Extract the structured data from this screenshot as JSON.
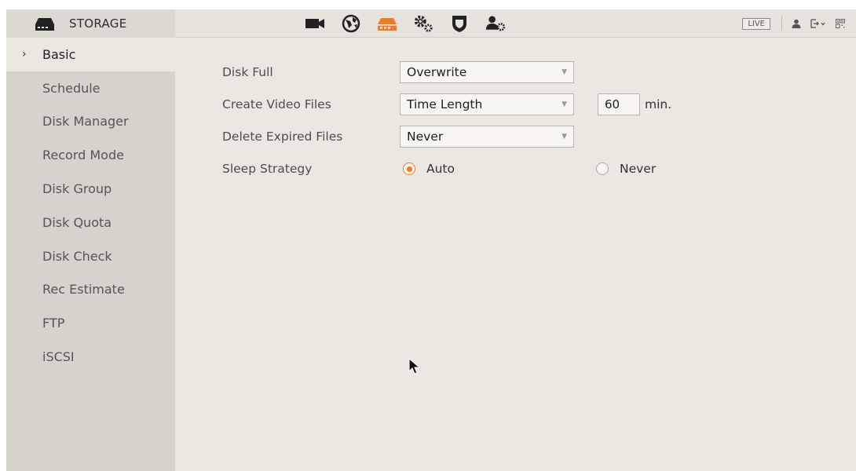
{
  "header": {
    "title": "STORAGE",
    "live_label": "LIVE",
    "nav_icons": [
      "camera-icon",
      "network-icon",
      "storage-icon",
      "system-settings-icon",
      "security-shield-icon",
      "account-settings-icon"
    ],
    "active_nav": "storage-icon",
    "tools": [
      "user-icon",
      "logout-icon",
      "qr-code-icon"
    ]
  },
  "sidebar": {
    "items": [
      {
        "label": "Basic",
        "active": true
      },
      {
        "label": "Schedule"
      },
      {
        "label": "Disk Manager"
      },
      {
        "label": "Record Mode"
      },
      {
        "label": "Disk Group"
      },
      {
        "label": "Disk Quota"
      },
      {
        "label": "Disk Check"
      },
      {
        "label": "Rec Estimate"
      },
      {
        "label": "FTP"
      },
      {
        "label": "iSCSI"
      }
    ]
  },
  "form": {
    "disk_full": {
      "label": "Disk Full",
      "value": "Overwrite"
    },
    "create_video_files": {
      "label": "Create Video Files",
      "value": "Time Length",
      "length": "60",
      "unit": "min."
    },
    "delete_expired_files": {
      "label": "Delete Expired Files",
      "value": "Never"
    },
    "sleep_strategy": {
      "label": "Sleep Strategy",
      "options": [
        "Auto",
        "Never"
      ],
      "selected": "Auto"
    }
  },
  "colors": {
    "accent": "#f07a2a",
    "sidebar_bg": "#d6d3cc",
    "content_bg": "#ebe8e2"
  }
}
